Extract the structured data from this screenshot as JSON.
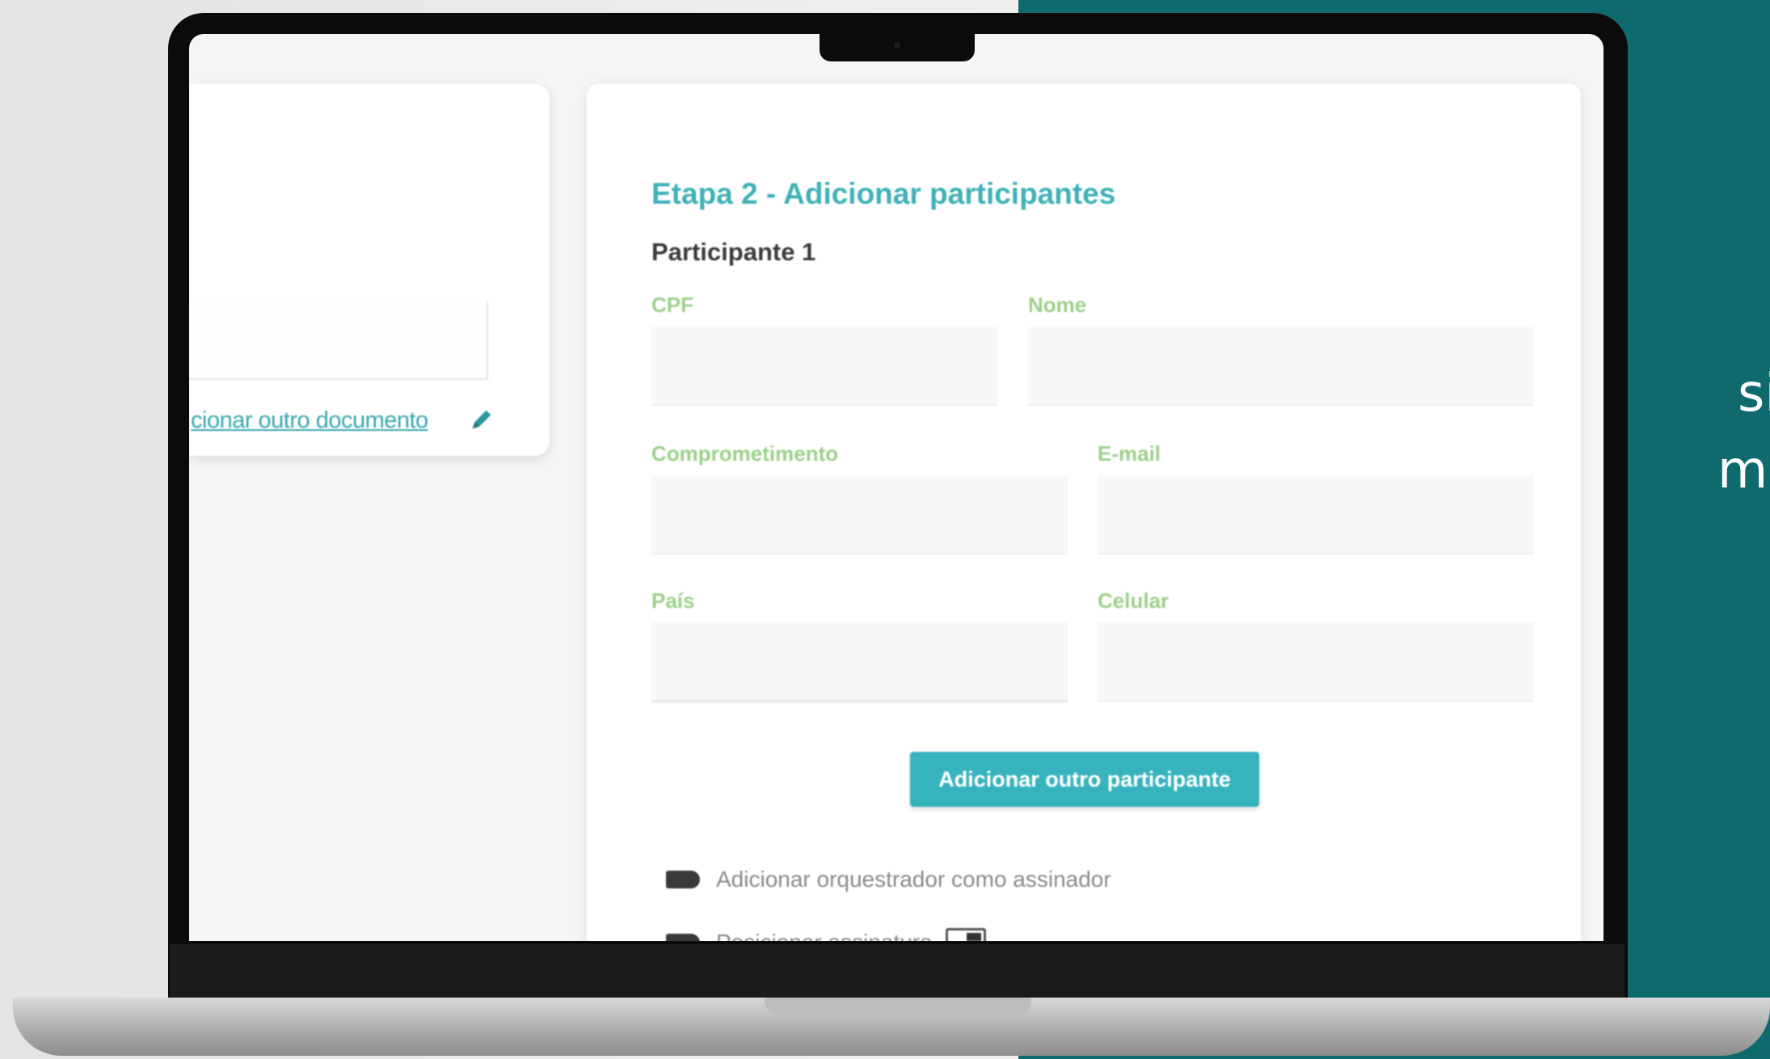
{
  "side_text": {
    "line1": "si",
    "line2": "m"
  },
  "left_card": {
    "add_document_link": "cionar outro documento"
  },
  "form": {
    "step_title": "Etapa 2 - Adicionar participantes",
    "participant_title": "Participante 1",
    "fields": {
      "cpf_label": "CPF",
      "nome_label": "Nome",
      "comprometimento_label": "Comprometimento",
      "email_label": "E-mail",
      "pais_label": "País",
      "celular_label": "Celular"
    },
    "add_participant_button": "Adicionar outro participante",
    "options": {
      "add_orchestrator_label": "Adicionar orquestrador como assinador",
      "position_signature_label": "Posicionar assinatura"
    }
  },
  "colors": {
    "teal_background": "#0f6a6d",
    "accent": "#37b3bd",
    "label_green": "#9bd18a"
  }
}
